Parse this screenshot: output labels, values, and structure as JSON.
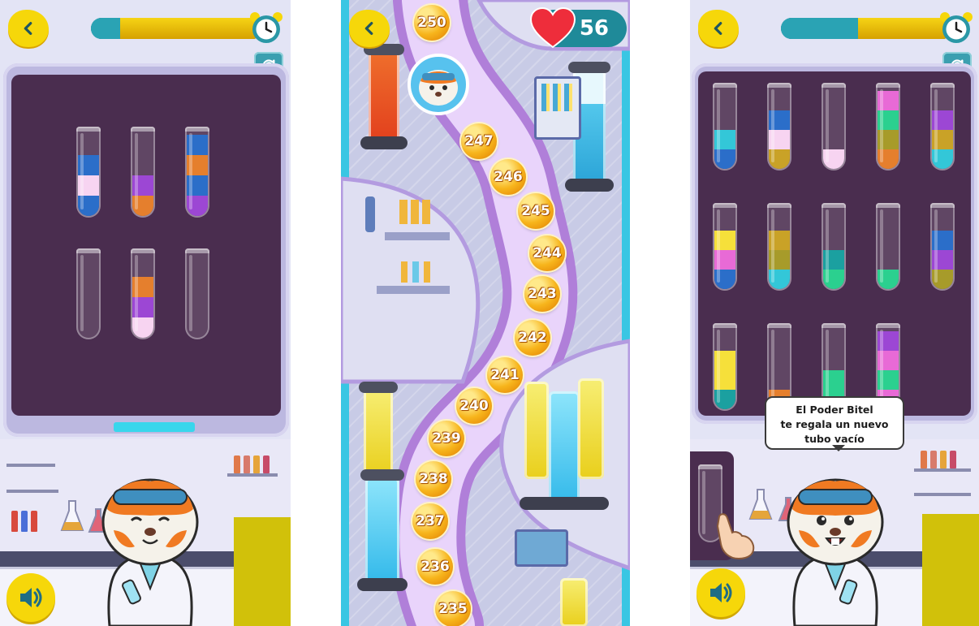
{
  "screens": {
    "left": {
      "timer": {
        "progress": 0.17
      },
      "tubes": [
        {
          "layers": [
            "#2b6ec9",
            "#f7d4f1",
            "#2b6ec9"
          ]
        },
        {
          "layers": [
            "#e57f2d",
            "#9c47d4"
          ]
        },
        {
          "layers": [
            "#9c47d4",
            "#2b6ec9",
            "#e57f2d",
            "#2b6ec9"
          ]
        },
        {
          "layers": []
        },
        {
          "layers": [
            "#f7d4f1",
            "#9c47d4",
            "#e57f2d"
          ]
        },
        {
          "layers": []
        }
      ]
    },
    "middle": {
      "lives": "56",
      "levels": [
        "250",
        "247",
        "246",
        "245",
        "244",
        "243",
        "242",
        "241",
        "240",
        "239",
        "238",
        "237",
        "236",
        "235"
      ]
    },
    "right": {
      "timer": {
        "progress": 0.45
      },
      "tubes": [
        {
          "layers": [
            "#2b6ec9",
            "#33c7d8"
          ]
        },
        {
          "layers": [
            "#c9a227",
            "#f7d4f1",
            "#2b6ec9"
          ]
        },
        {
          "layers": [
            "#f7d4f1"
          ]
        },
        {
          "layers": [
            "#e57f2d",
            "#a79b2a",
            "#2bd08f",
            "#e86ad6"
          ]
        },
        {
          "layers": [
            "#33c7d8",
            "#c9a227",
            "#9c47d4"
          ]
        },
        {
          "layers": [
            "#2b6ec9",
            "#e86ad6",
            "#f6e03a"
          ]
        },
        {
          "layers": [
            "#33c7d8",
            "#a79b2a",
            "#c9a227"
          ]
        },
        {
          "layers": [
            "#2bd08f",
            "#1ba0a0"
          ]
        },
        {
          "layers": [
            "#2bd08f"
          ]
        },
        {
          "layers": [
            "#a79b2a",
            "#9c47d4",
            "#2b6ec9"
          ]
        },
        {
          "layers": [
            "#1ba0a0",
            "#f6e03a",
            "#f6e03a"
          ]
        },
        {
          "layers": [
            "#e57f2d"
          ]
        },
        {
          "layers": [
            "#2bd08f",
            "#2bd08f"
          ]
        },
        {
          "layers": [
            "#e86ad6",
            "#2bd08f",
            "#e86ad6",
            "#9c47d4"
          ]
        }
      ],
      "speech": {
        "line1": "El Poder Bitel",
        "line2": "te regala un nuevo",
        "line3": "tubo vacío"
      }
    }
  },
  "icons": {
    "back": "chevron-left-icon",
    "timer": "alarm-clock-icon",
    "restart": "restart-icon",
    "sound": "speaker-icon",
    "lives": "heart-icon"
  },
  "colors": {
    "accent_yellow": "#f6d70a",
    "board": "#4a2d4f",
    "teal": "#1f8a99"
  }
}
